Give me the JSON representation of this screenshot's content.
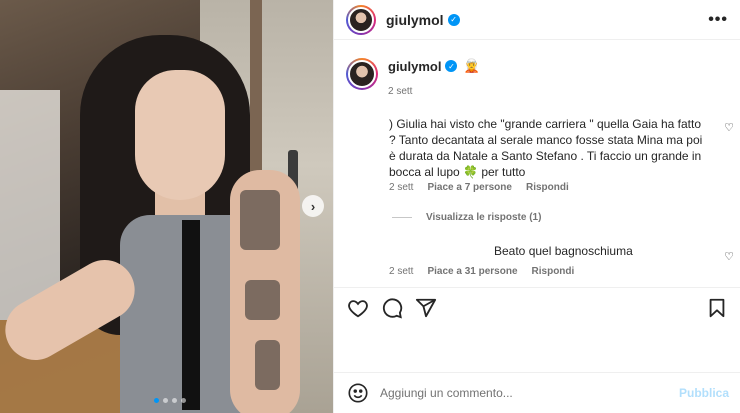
{
  "post": {
    "username": "giulymol",
    "verified": "✓"
  },
  "photo": {
    "next_arrow": "›",
    "dots_count": 4,
    "active_dot": 0
  },
  "caption": {
    "username": "giulymol",
    "verified": "✓",
    "emoji": "🧝",
    "time": "2 sett"
  },
  "comments": [
    {
      "text": ") Giulia hai visto che \"grande carriera \" quella Gaia ha fatto ? Tanto decantata al serale manco fosse stata Mina ma poi è durata da Natale a Santo Stefano . Ti faccio un grande in bocca al lupo 🍀 per tutto",
      "time": "2 sett",
      "likes": "Piace a 7 persone",
      "reply": "Rispondi",
      "view_replies": "Visualizza le risposte (1)"
    },
    {
      "text": "Beato quel bagnoschiuma",
      "time": "2 sett",
      "likes": "Piace a 31 persone",
      "reply": "Rispondi"
    }
  ],
  "composer": {
    "placeholder": "Aggiungi un commento...",
    "publish": "Pubblica"
  },
  "colors": {
    "accent": "#0095f6",
    "publish_disabled": "#b2dffc"
  }
}
